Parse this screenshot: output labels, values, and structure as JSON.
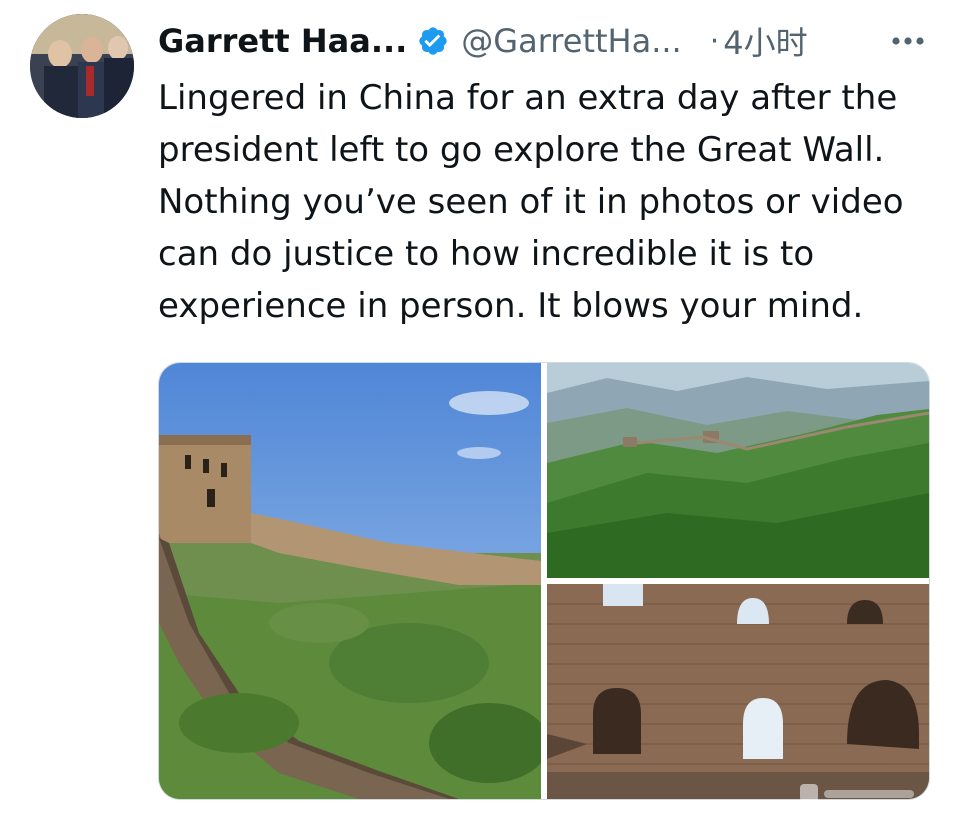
{
  "tweet": {
    "author_name": "Garrett Haa...",
    "handle": "@GarrettHa...",
    "separator": "·",
    "time": "4小时",
    "text": "Lingered in China for an extra day after the president left to go explore the Great Wall. Nothing you’ve seen of it in photos or video can do justice to how incredible it is to experience in person. It blows your mind."
  },
  "icons": {
    "verified": "verified-badge-icon",
    "more": "more-horizontal-icon"
  },
  "colors": {
    "text": "#0f1419",
    "secondary_text": "#536471",
    "verified_blue": "#1d9bf0",
    "media_border": "#cfd9de"
  },
  "media": {
    "photos": [
      {
        "subject": "great-wall-slope-blue-sky"
      },
      {
        "subject": "great-wall-green-mountains"
      },
      {
        "subject": "great-wall-brick-watchtower"
      }
    ]
  }
}
